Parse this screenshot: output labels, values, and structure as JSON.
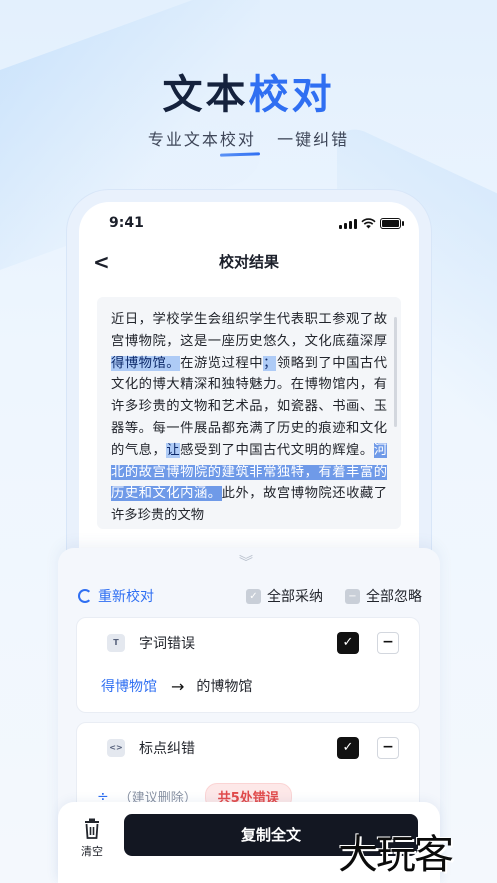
{
  "hero": {
    "title_a": "文本",
    "title_b": "校对",
    "subtitle_a": "专业",
    "subtitle_b": "文本校对",
    "subtitle_c": "一键纠错"
  },
  "status_bar": {
    "time": "9:41"
  },
  "nav": {
    "back_icon": "<",
    "title": "校对结果"
  },
  "text": {
    "s1": "近日，学校学生会组织学生代表职工参观了故宫博物院，这是一座历史悠久，文化底蕴深厚",
    "h1": "得博物馆。",
    "s2": "在游览过程中",
    "h2": "；",
    "s3": "领略到了中国古代文化的博大精深和独特魅力。在博物馆内，有许多珍贵的文物和艺术品，如瓷器、书画、玉器等。每一件展品都充满了历史的痕迹和文化的气息，",
    "h3": "让",
    "s4": "感受到了中国古代文明的辉煌。",
    "h4": "河北的故宫博物院的建筑非常独特，有着丰富的历史和文化内涵。",
    "s5": "此外，故宫博物院还收藏了许多珍贵的文物"
  },
  "actions": {
    "recheck": "重新校对",
    "accept_all": "全部采纳",
    "ignore_all": "全部忽略"
  },
  "cards": [
    {
      "icon": "T",
      "label": "字词错误",
      "wrong": "得博物馆",
      "arrow": "→",
      "right": "的博物馆"
    },
    {
      "icon": "<>",
      "label": "标点纠错",
      "sym": "÷",
      "suggestion": "（建议删除）",
      "error_count": "共5处错误"
    }
  ],
  "bottom": {
    "clear": "清空",
    "copy": "复制全文"
  },
  "watermark": "大玩客"
}
